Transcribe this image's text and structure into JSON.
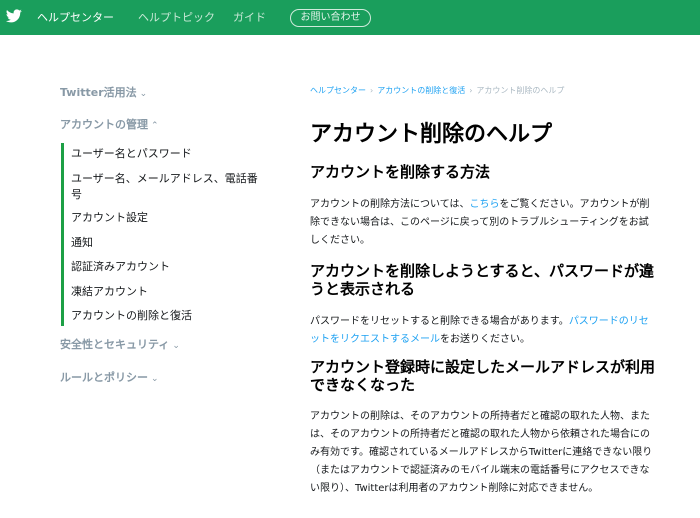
{
  "header": {
    "brand_color": "#1a9e5c",
    "logo_icon": "bird-icon",
    "nav": {
      "help_center": "ヘルプセンター",
      "help_topics": "ヘルプトピック",
      "guide": "ガイド",
      "contact": "お問い合わせ"
    }
  },
  "sidebar": {
    "accent_color": "#1da045",
    "sections": [
      {
        "label": "Twitter活用法",
        "chevron": "⌄"
      },
      {
        "label": "アカウントの管理",
        "chevron": "⌃"
      },
      {
        "label": "安全性とセキュリティ",
        "chevron": "⌄"
      },
      {
        "label": "ルールとポリシー",
        "chevron": "⌄"
      }
    ],
    "items": [
      {
        "label": "ユーザー名とパスワード"
      },
      {
        "label": "ユーザー名、メールアドレス、電話番号"
      },
      {
        "label": "アカウント設定"
      },
      {
        "label": "通知"
      },
      {
        "label": "認証済みアカウント"
      },
      {
        "label": "凍結アカウント"
      },
      {
        "label": "アカウントの削除と復活"
      }
    ]
  },
  "breadcrumb": {
    "items": [
      "ヘルプセンター",
      "アカウントの削除と復活",
      "アカウント削除のヘルプ"
    ],
    "separator": "›"
  },
  "article": {
    "title": "アカウント削除のヘルプ",
    "sections": [
      {
        "heading": "アカウントを削除する方法",
        "body_before": "アカウントの削除方法については、",
        "link": "こちら",
        "body_after": "をご覧ください。アカウントが削除できない場合は、このページに戻って別のトラブルシューティングをお試しください。"
      },
      {
        "heading": "アカウントを削除しようとすると、パスワードが違うと表示される",
        "body_before": "パスワードをリセットすると削除できる場合があります。",
        "link": "パスワードのリセットをリクエストするメール",
        "body_after": "をお送りください。"
      },
      {
        "heading": "アカウント登録時に設定したメールアドレスが利用できなくなった",
        "body": "アカウントの削除は、そのアカウントの所持者だと確認の取れた人物、または、そのアカウントの所持者だと確認の取れた人物から依頼された場合にのみ有効です。確認されているメールアドレスからTwitterに連絡できない限り（またはアカウントで認証済みのモバイル端末の電話番号にアクセスできない限り）、Twitterは利用者のアカウント削除に対応できません。"
      }
    ]
  }
}
